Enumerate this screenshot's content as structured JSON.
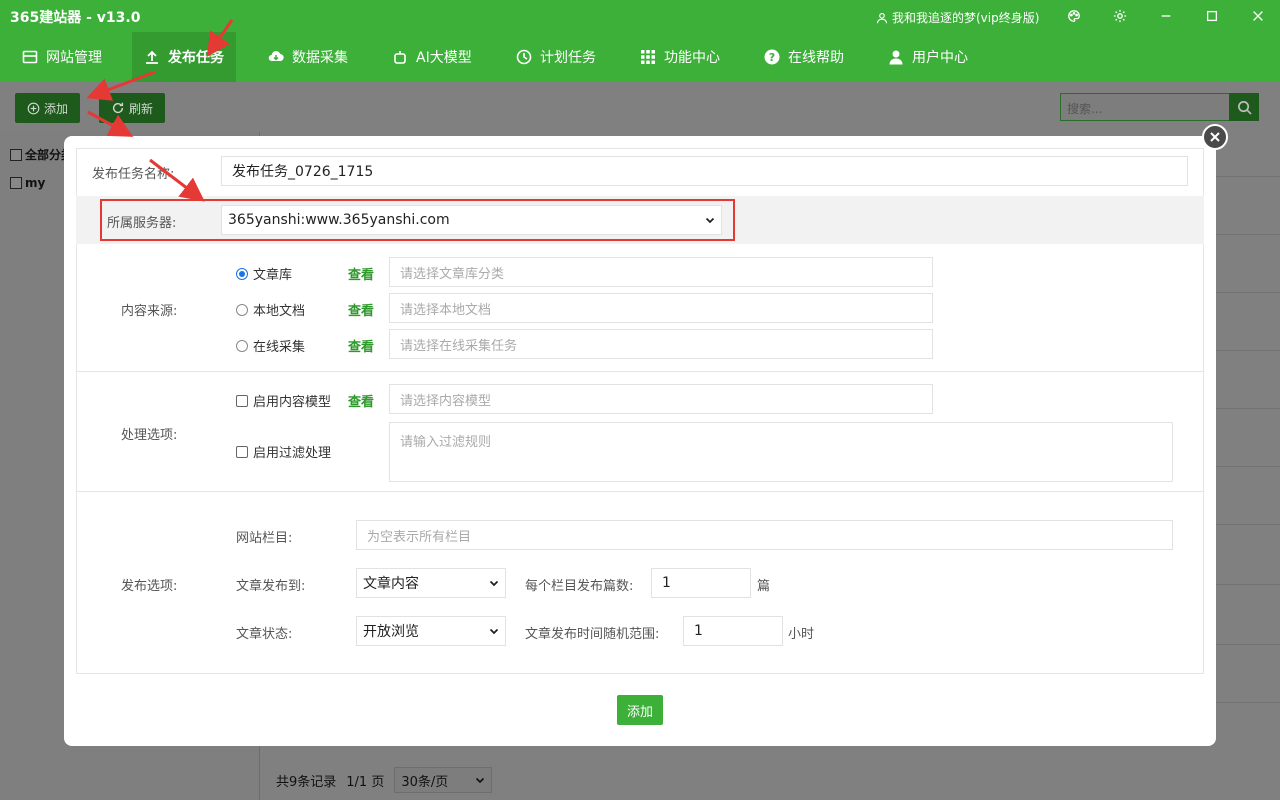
{
  "app": {
    "title": "365建站器 - v13.0",
    "user": "我和我追逐的梦(vip终身版)"
  },
  "nav": {
    "items": [
      {
        "label": "网站管理",
        "icon": "window-icon"
      },
      {
        "label": "发布任务",
        "icon": "upload-icon",
        "active": true
      },
      {
        "label": "数据采集",
        "icon": "cloud-download-icon"
      },
      {
        "label": "AI大模型",
        "icon": "robot-icon"
      },
      {
        "label": "计划任务",
        "icon": "clock-icon"
      },
      {
        "label": "功能中心",
        "icon": "grid-icon"
      },
      {
        "label": "在线帮助",
        "icon": "help-icon"
      },
      {
        "label": "用户中心",
        "icon": "user-icon"
      }
    ]
  },
  "toolbar": {
    "add_label": "添加",
    "refresh_label": "刷新",
    "search_placeholder": "搜索..."
  },
  "left_panel": {
    "all_label": "全部分类",
    "item_label": "my"
  },
  "footer": {
    "records": "共9条记录",
    "pages": "1/1 页",
    "page_size": "30条/页"
  },
  "form": {
    "task_name_label": "发布任务名称:",
    "task_name_value": "发布任务_0726_1715",
    "server_label": "所属服务器:",
    "server_value": "365yanshi:www.365yanshi.com",
    "content_source_label": "内容来源:",
    "sources": [
      {
        "label": "文章库",
        "placeholder": "请选择文章库分类",
        "checked": true
      },
      {
        "label": "本地文档",
        "placeholder": "请选择本地文档",
        "checked": false
      },
      {
        "label": "在线采集",
        "placeholder": "请选择在线采集任务",
        "checked": false
      }
    ],
    "view_label": "查看",
    "processing_label": "处理选项:",
    "content_model_label": "启用内容模型",
    "content_model_placeholder": "请选择内容模型",
    "filter_label": "启用过滤处理",
    "filter_placeholder": "请输入过滤规则",
    "publish_label": "发布选项:",
    "column_label": "网站栏目:",
    "column_placeholder": "为空表示所有栏目",
    "publish_to_label": "文章发布到:",
    "publish_to_value": "文章内容",
    "per_column_label": "每个栏目发布篇数:",
    "per_column_value": "1",
    "per_column_unit": "篇",
    "status_label": "文章状态:",
    "status_value": "开放浏览",
    "random_label": "文章发布时间随机范围:",
    "random_value": "1",
    "random_unit": "小时",
    "submit_label": "添加"
  },
  "colors": {
    "brand": "#3db03a",
    "annotation": "#e53935"
  }
}
